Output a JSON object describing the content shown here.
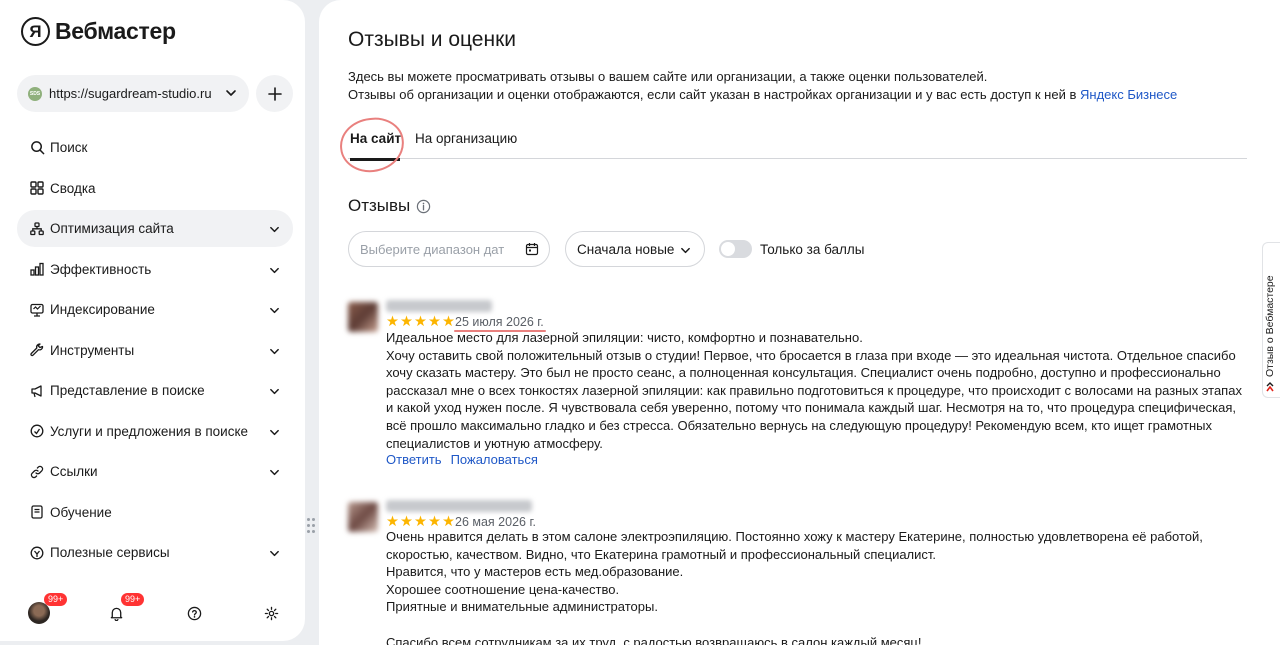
{
  "app": {
    "name": "Вебмастер",
    "logo_letter": "Я"
  },
  "site_selector": {
    "url": "https://sugardream-studio.ru",
    "favicon_text": "SDS"
  },
  "sidebar": {
    "items": [
      {
        "label": "Поиск",
        "icon": "search-icon",
        "expandable": false,
        "active": false
      },
      {
        "label": "Сводка",
        "icon": "dashboard-icon",
        "expandable": false,
        "active": false
      },
      {
        "label": "Оптимизация сайта",
        "icon": "structure-icon",
        "expandable": true,
        "active": true
      },
      {
        "label": "Эффективность",
        "icon": "bar-chart-icon",
        "expandable": true,
        "active": false
      },
      {
        "label": "Индексирование",
        "icon": "monitor-icon",
        "expandable": true,
        "active": false
      },
      {
        "label": "Инструменты",
        "icon": "wrench-icon",
        "expandable": true,
        "active": false
      },
      {
        "label": "Представление в поиске",
        "icon": "megaphone-icon",
        "expandable": true,
        "active": false
      },
      {
        "label": "Услуги и предложения в поиске",
        "icon": "tag-icon",
        "expandable": true,
        "active": false
      },
      {
        "label": "Ссылки",
        "icon": "link-icon",
        "expandable": true,
        "active": false
      },
      {
        "label": "Обучение",
        "icon": "book-icon",
        "expandable": false,
        "active": false
      },
      {
        "label": "Полезные сервисы",
        "icon": "services-icon",
        "expandable": true,
        "active": false
      }
    ],
    "bottom": {
      "profile_badge": "99+",
      "notifications_badge": "99+"
    }
  },
  "page": {
    "title": "Отзывы и оценки",
    "description_line1": "Здесь вы можете просматривать отзывы о вашем сайте или организации, а также оценки пользователей.",
    "description_line2": "Отзывы об организации и оценки отображаются, если сайт указан в настройках организации и у вас есть доступ к ней в",
    "description_link": "Яндекс Бизнесе",
    "tabs": [
      {
        "label": "На сайт",
        "active": true
      },
      {
        "label": "На организацию",
        "active": false
      }
    ]
  },
  "reviews_section": {
    "title": "Отзывы",
    "filters": {
      "date_placeholder": "Выберите диапазон дат",
      "sort_value": "Сначала новые",
      "toggle_label": "Только за баллы",
      "toggle_on": false
    },
    "reviews": [
      {
        "rating": 5,
        "date": "25 июля 2026 г.",
        "paragraphs": [
          "Идеальное место для лазерной эпиляции: чисто, комфортно и познавательно.",
          "Хочу оставить свой положительный отзыв о студии! Первое, что бросается в глаза при входе — это идеальная чистота. Отдельное спасибо хочу сказать мастеру. Это был не просто сеанс, а полноценная консультация. Специалист очень подробно, доступно и профессионально рассказал мне о всех тонкостях лазерной эпиляции: как правильно подготовиться к процедуре, что происходит с волосами на разных этапах и какой уход нужен после. Я чувствовала себя уверенно, потому что понимала каждый шаг. Несмотря на то, что процедура специфическая, всё прошло максимально гладко и без стресса. Обязательно вернусь на следующую процедуру! Рекомендую всем, кто ищет грамотных специалистов и уютную атмосферу."
        ],
        "reply_label": "Ответить",
        "report_label": "Пожаловаться"
      },
      {
        "rating": 5,
        "date": "26 мая 2026 г.",
        "paragraphs": [
          "Очень нравится делать в этом салоне электроэпиляцию. Постоянно хожу к мастеру Екатерине, полностью удовлетворена её работой, скоростью, качеством. Видно, что Екатерина грамотный и профессиональный специалист.",
          "Нравится, что у мастеров есть мед.образование.",
          "Хорошее соотношение цена-качество.",
          "Приятные и внимательные администраторы.",
          "",
          "Спасибо всем сотрудникам за их труд, с радостью возвращаюсь в салон каждый месяц!"
        ]
      }
    ]
  },
  "feedback_widget": {
    "label": "Отзыв о Вебмастере"
  },
  "colors": {
    "link": "#1f58c7",
    "star": "#fcb500",
    "annotation": "#e9807e",
    "badge": "#ff3333"
  }
}
